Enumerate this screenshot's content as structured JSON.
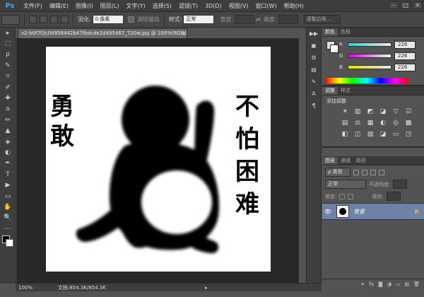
{
  "app": {
    "logo": "Ps"
  },
  "menu": [
    "文件(F)",
    "编辑(E)",
    "图像(I)",
    "图层(L)",
    "文字(Y)",
    "选择(S)",
    "滤镜(T)",
    "3D(D)",
    "视图(V)",
    "窗口(W)",
    "帮助(H)"
  ],
  "window_buttons": [
    "–",
    "□",
    "✕"
  ],
  "options": {
    "feather_label": "羽化:",
    "feather_value": "0 像素",
    "antialias_label": "消除锯齿",
    "style_label": "样式:",
    "style_value": "正常",
    "width_label": "宽度:",
    "height_label": "高度:",
    "refine_edge": "调整边缘..."
  },
  "document": {
    "tab_title": "v2-b0f7f3c04956442b47fbdcde2d495467_720w.jpg @ 100%(RGB/8#)",
    "close": "×",
    "text_left": [
      "勇",
      "敢"
    ],
    "text_right": [
      "不",
      "怕",
      "困",
      "难"
    ]
  },
  "status": {
    "zoom": "100%",
    "doc_info": "文档:854.3K/854.3K",
    "arrow": "▸"
  },
  "color_panel": {
    "tabs": [
      "颜色",
      "色板"
    ],
    "channels": [
      {
        "label": "R",
        "value": "226"
      },
      {
        "label": "G",
        "value": "226"
      },
      {
        "label": "B",
        "value": "226"
      }
    ],
    "fg_color": "#e2e2e2",
    "bg_color": "#ffffff"
  },
  "adjust_panel": {
    "tabs": [
      "调整",
      "样式"
    ],
    "heading": "添加调整",
    "icons": [
      "☀",
      "▥",
      "◩",
      "◪",
      "▽",
      "☑",
      "▤",
      "⚖",
      "▦",
      "◐",
      "◎",
      "▩",
      "◧",
      "◫",
      "▨",
      "◪",
      "▭",
      "◳"
    ]
  },
  "layers_panel": {
    "tabs": [
      "图层",
      "通道",
      "路径"
    ],
    "kind_label": "ρ 类型",
    "blend_mode": "正常",
    "opacity_label": "不透明度:",
    "lock_label": "锁定:",
    "fill_label": "填充:",
    "layer_name": "背景",
    "eye": "👁",
    "lock": "🔒",
    "footer_icons": [
      "⚭",
      "fx",
      "◙",
      "◑",
      "▭",
      "▤",
      "🗑"
    ]
  },
  "tools": [
    "▸",
    "⬚",
    "ρ",
    "✎",
    "⌗",
    "✐",
    "✚",
    "⌂",
    "✏",
    "▲",
    "◈",
    "◐",
    "✒",
    "T",
    "▶",
    "▭",
    "✋",
    "🔍",
    "⋯",
    "◧"
  ],
  "strip_icons": [
    "▶▶",
    "▣",
    "⚙",
    "▤",
    "✎",
    "Α",
    "¶"
  ]
}
